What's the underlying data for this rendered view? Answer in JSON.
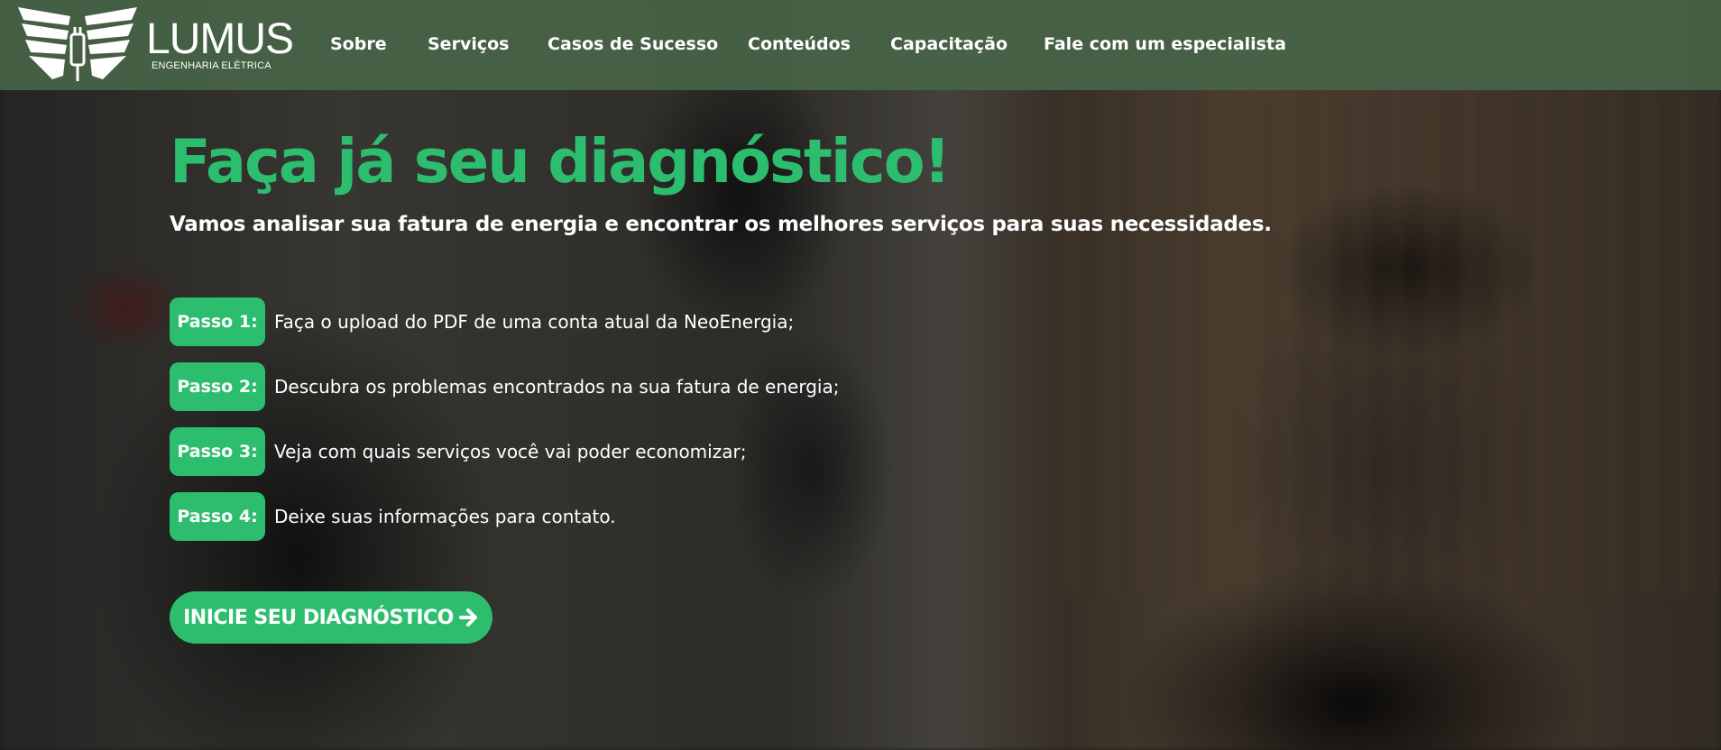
{
  "brand": {
    "name": "LUMUS",
    "tagline": "ENGENHARIA ELÉTRICA",
    "logo_icon": "wings-plug-icon"
  },
  "nav": {
    "items": [
      {
        "label": "Sobre"
      },
      {
        "label": "Serviços"
      },
      {
        "label": "Casos de Sucesso"
      },
      {
        "label": "Conteúdos"
      },
      {
        "label": "Capacitação"
      },
      {
        "label": "Fale com um especialista"
      }
    ]
  },
  "hero": {
    "title": "Faça já seu diagnóstico!",
    "subtitle": "Vamos analisar sua fatura de energia e encontrar os melhores serviços para suas necessidades.",
    "steps": [
      {
        "badge": "Passo 1:",
        "text": "Faça o upload do PDF de uma conta atual da NeoEnergia;"
      },
      {
        "badge": "Passo 2:",
        "text": "Descubra os problemas encontrados na sua fatura de energia;"
      },
      {
        "badge": "Passo 3:",
        "text": "Veja com quais serviços você vai poder economizar;"
      },
      {
        "badge": "Passo 4:",
        "text": "Deixe suas informações para contato."
      }
    ],
    "cta": {
      "label": "INICIE SEU DIAGNÓSTICO",
      "icon": "arrow-right-icon"
    }
  },
  "colors": {
    "accent": "#2dbd6e",
    "header_bg": "#486448",
    "text": "#ffffff"
  }
}
